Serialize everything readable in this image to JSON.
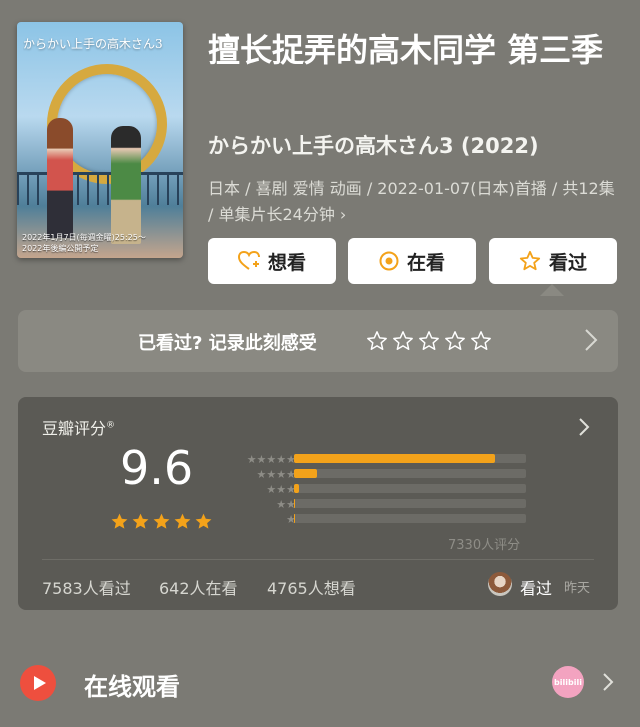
{
  "poster": {
    "title_jp": "からかい上手の高木さん3",
    "caption_line1": "2022年1月7日(毎週金曜)25:25〜",
    "caption_line2": "2022年後編公開予定"
  },
  "title": "擅长捉弄的高木同学 第三季",
  "subtitle": "からかい上手の高木さん3 (2022)",
  "meta": "日本 / 喜剧 爱情 动画 / 2022-01-07(日本)首播 / 共12集 / 单集片长24分钟 ›",
  "buttons": {
    "want": "想看",
    "watching": "在看",
    "watched": "看过"
  },
  "record": {
    "prompt": "已看过? 记录此刻感受",
    "stars": 0
  },
  "rating": {
    "label": "豆瓣评分",
    "reg": "®",
    "score": "9.6",
    "stars": 5,
    "distribution": [
      {
        "stars": "★★★★★",
        "percent": 86.5
      },
      {
        "stars": "★★★★",
        "percent": 10.0
      },
      {
        "stars": "★★★",
        "percent": 2.2
      },
      {
        "stars": "★★",
        "percent": 0.6
      },
      {
        "stars": "★",
        "percent": 0.5
      }
    ],
    "count": "7330人评分",
    "seen": "7583人看过",
    "watching": "642人在看",
    "wish": "4765人想看",
    "friend_status": "看过",
    "friend_time": "昨天"
  },
  "online": {
    "label": "在线观看",
    "platform": "bilibili"
  },
  "colors": {
    "accent": "#f3a21a",
    "play": "#ee4f3e",
    "background": "#7b7a74"
  }
}
